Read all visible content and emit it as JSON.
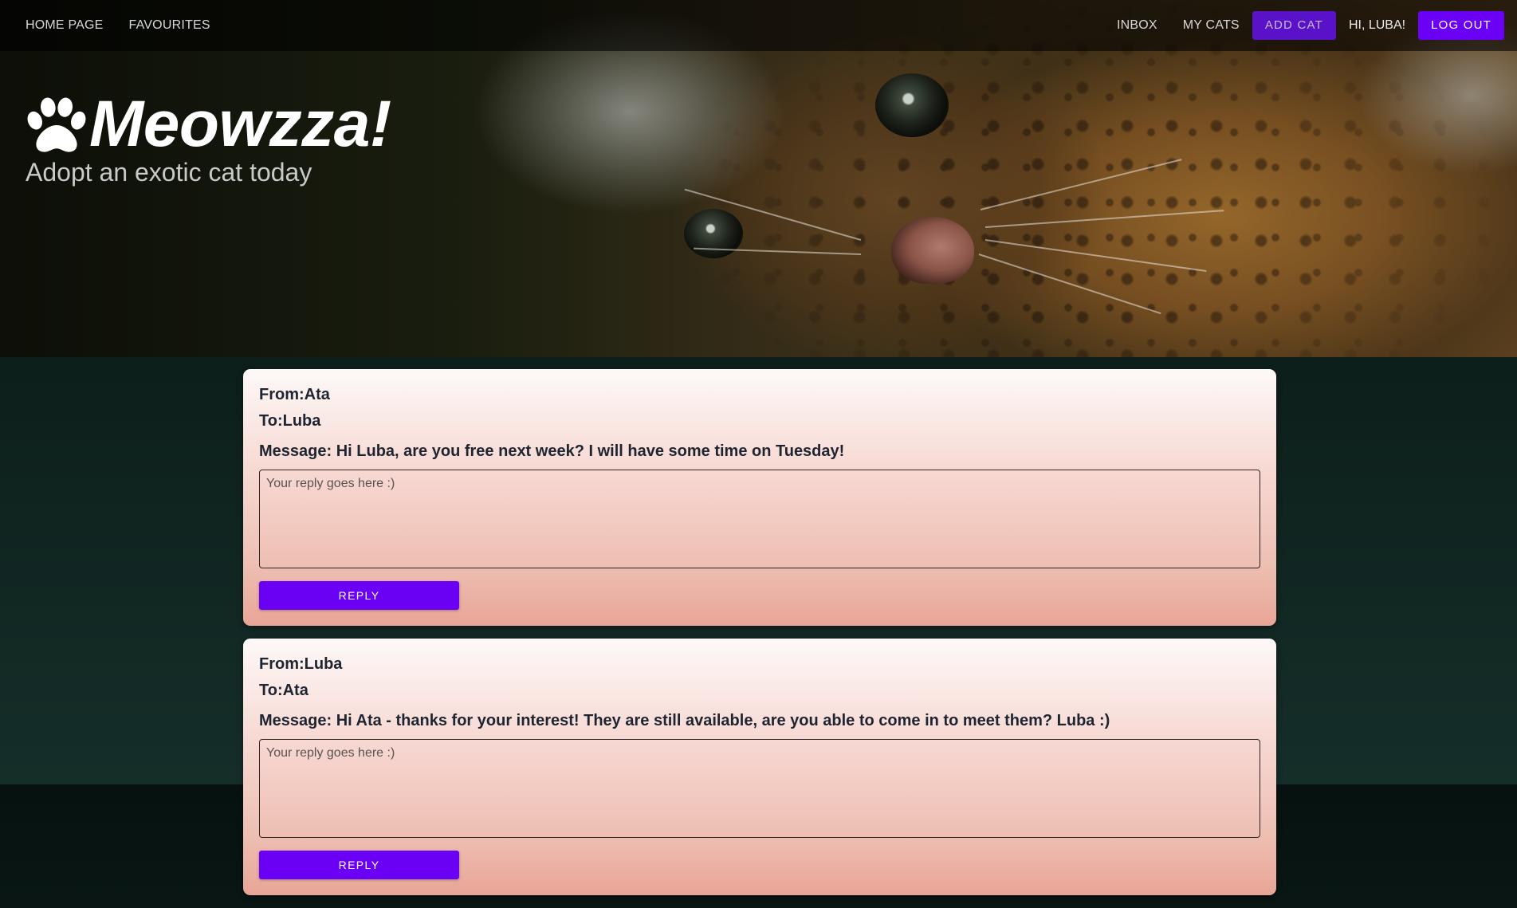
{
  "nav": {
    "left": [
      {
        "label": "HOME PAGE"
      },
      {
        "label": "FAVOURITES"
      }
    ],
    "inbox_label": "INBOX",
    "my_cats_label": "MY CATS",
    "add_cat_label": "ADD CAT",
    "greeting": "HI, LUBA!",
    "logout_label": "LOG OUT"
  },
  "brand": {
    "title": "Meowzza!",
    "subtitle": "Adopt an exotic cat today",
    "icon": "paw-icon"
  },
  "messages": [
    {
      "from": "From:Ata",
      "to": "To:Luba",
      "message": "Message: Hi Luba, are you free next week? I will have some time on Tuesday!",
      "reply_placeholder": "Your reply goes here :)",
      "reply_label": "REPLY"
    },
    {
      "from": "From:Luba",
      "to": "To:Ata",
      "message": "Message: Hi Ata - thanks for your interest! They are still available, are you able to come in to meet them? Luba :)",
      "reply_placeholder": "Your reply goes here :)",
      "reply_label": "REPLY"
    }
  ],
  "colors": {
    "primary_button": "#6a00f4",
    "add_cat_button": "#5a12c9",
    "page_background": "#0e211d"
  }
}
